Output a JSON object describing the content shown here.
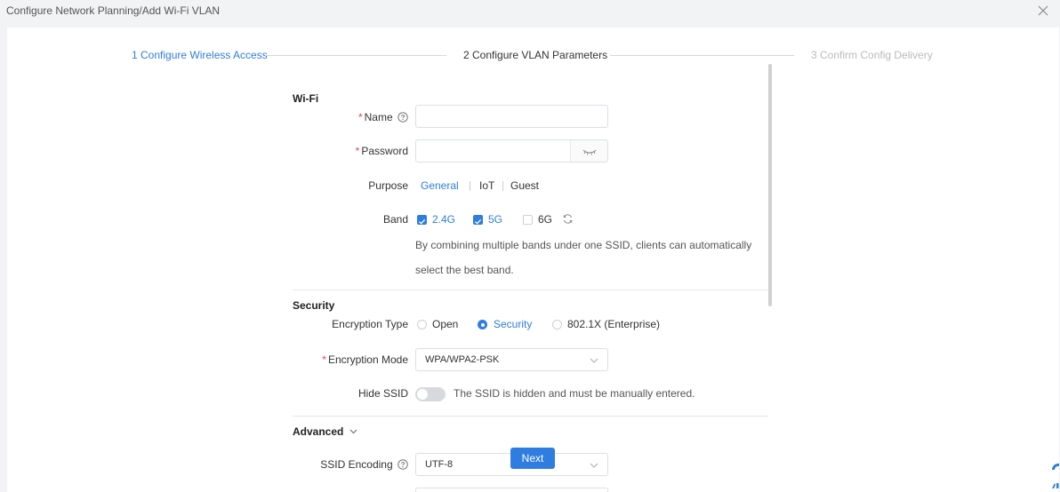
{
  "window": {
    "title": "Configure Network Planning/Add Wi-Fi VLAN"
  },
  "steps": [
    {
      "label": "1 Configure Wireless Access",
      "state": "done"
    },
    {
      "label": "2 Configure VLAN Parameters",
      "state": "current"
    },
    {
      "label": "3 Confirm Config Delivery",
      "state": "pending"
    }
  ],
  "wifi": {
    "section_title": "Wi-Fi",
    "name": {
      "label": "Name",
      "value": ""
    },
    "password": {
      "label": "Password",
      "value": ""
    },
    "purpose": {
      "label": "Purpose",
      "options": [
        "General",
        "IoT",
        "Guest"
      ],
      "selected": "General"
    },
    "band": {
      "label": "Band",
      "options": [
        {
          "label": "2.4G",
          "checked": true
        },
        {
          "label": "5G",
          "checked": true
        },
        {
          "label": "6G",
          "checked": false
        }
      ],
      "hint_line1": "By combining multiple bands under one SSID, clients can automatically",
      "hint_line2": "select the best band."
    }
  },
  "security": {
    "section_title": "Security",
    "encryption_type": {
      "label": "Encryption Type",
      "options": [
        "Open",
        "Security",
        "802.1X (Enterprise)"
      ],
      "selected": "Security"
    },
    "encryption_mode": {
      "label": "Encryption Mode",
      "value": "WPA/WPA2-PSK"
    },
    "hide_ssid": {
      "label": "Hide SSID",
      "enabled": false,
      "hint": "The SSID is hidden and must be manually entered."
    }
  },
  "advanced": {
    "section_title": "Advanced",
    "ssid_encoding": {
      "label": "SSID Encoding",
      "value": "UTF-8"
    }
  },
  "actions": {
    "next_label": "Next"
  },
  "colors": {
    "accent": "#2f7de1",
    "required": "#e54545",
    "muted": "#bbbbbb"
  },
  "icons": [
    "close-icon",
    "help-icon",
    "eye-hidden-icon",
    "refresh-icon",
    "chevron-down-icon",
    "assistant-icon"
  ]
}
